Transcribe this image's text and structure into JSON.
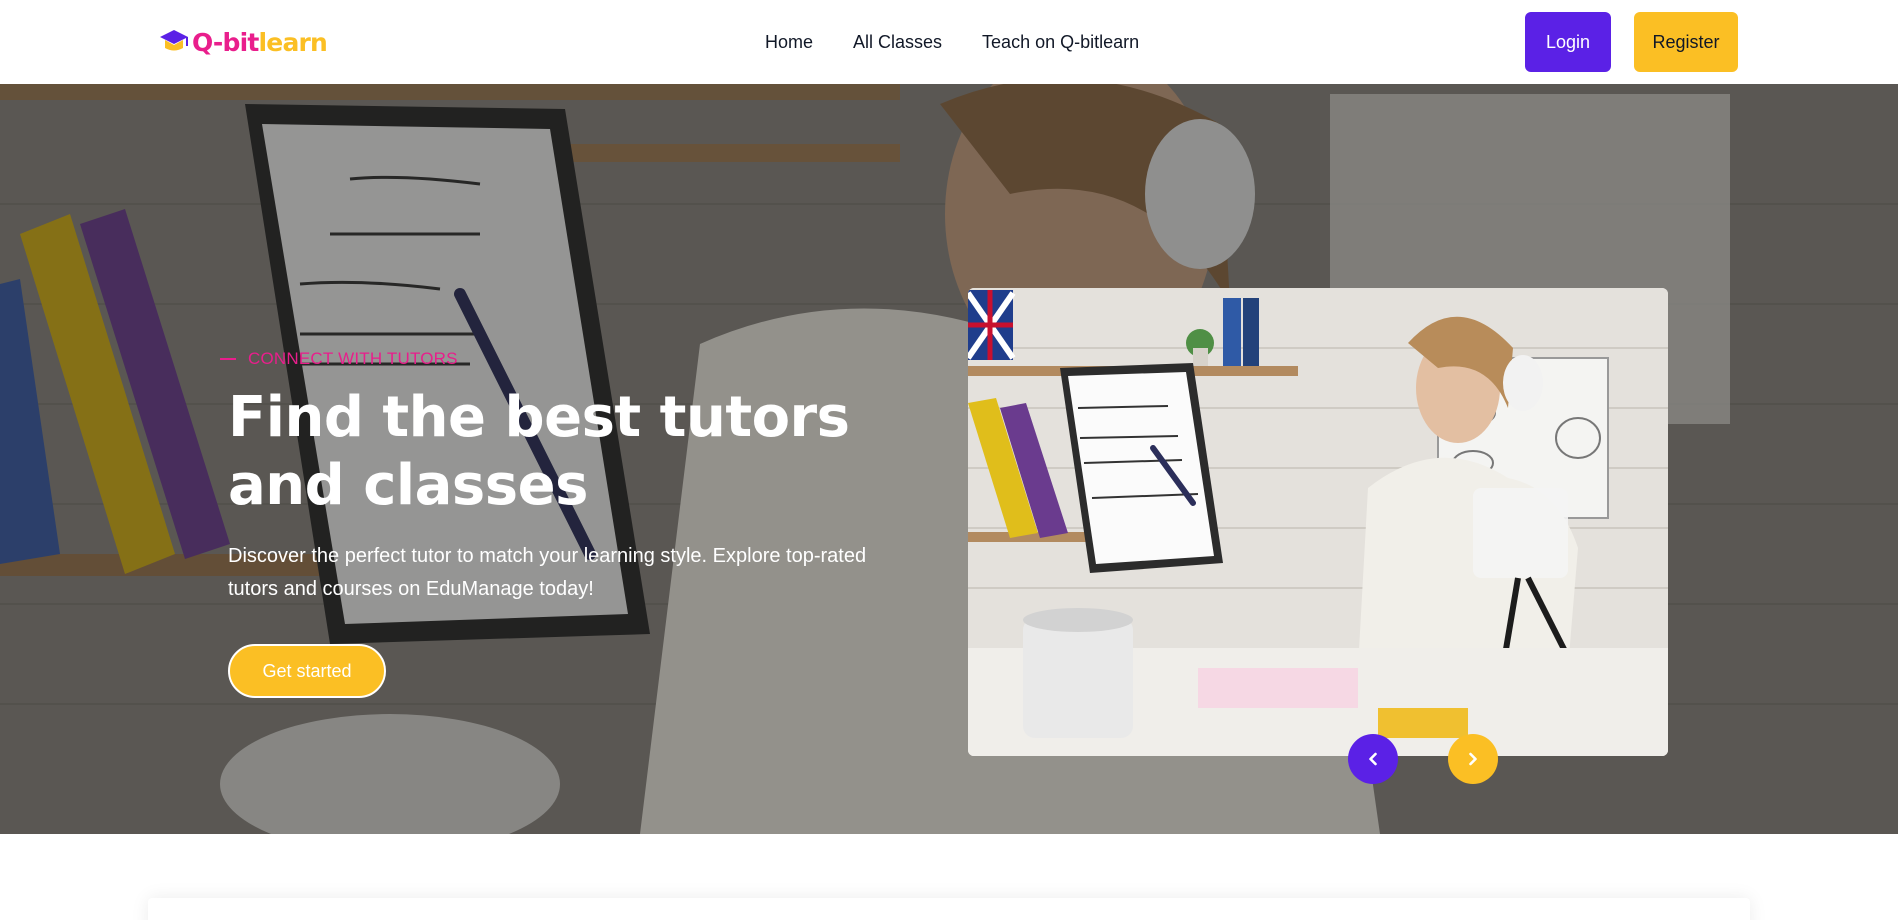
{
  "brand": {
    "name_part1": "Q-bit",
    "name_part2": "learn",
    "logo_icon": "graduation-cap-icon",
    "color_pink": "#e91e8c",
    "color_yellow": "#fbbf24"
  },
  "nav": {
    "links": [
      {
        "label": "Home"
      },
      {
        "label": "All Classes"
      },
      {
        "label": "Teach on Q-bitlearn"
      }
    ],
    "login_label": "Login",
    "register_label": "Register"
  },
  "hero": {
    "eyebrow": "Connect with tutors",
    "title_line1": "Find the best tutors",
    "title_line2": "and classes",
    "description": "Discover the perfect tutor to match your learning style. Explore top-rated tutors and courses on EduManage today!",
    "cta_label": "Get started",
    "carousel": {
      "prev_icon": "chevron-left-icon",
      "next_icon": "chevron-right-icon"
    }
  },
  "colors": {
    "primary_purple": "#5b21e6",
    "accent_yellow": "#fbbf24",
    "accent_pink": "#e91e8c",
    "text_dark": "#111827"
  }
}
